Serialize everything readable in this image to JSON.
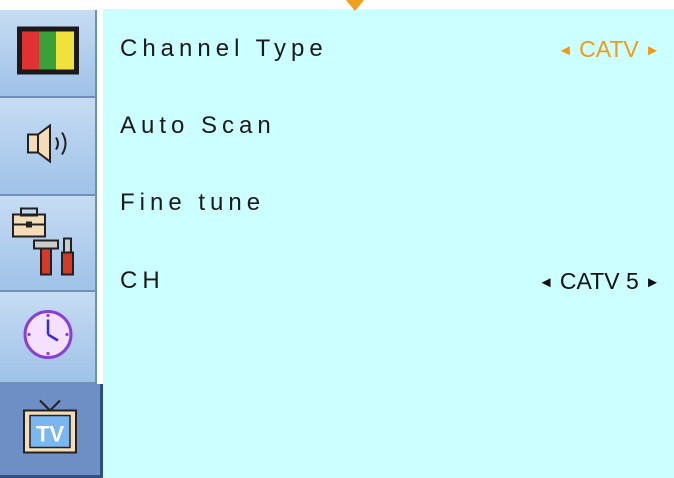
{
  "sidebar": {
    "tabs": [
      {
        "name": "picture",
        "icon": "color-bars-icon",
        "active": false
      },
      {
        "name": "sound",
        "icon": "speaker-icon",
        "active": false
      },
      {
        "name": "setup",
        "icon": "toolbox-icon",
        "active": false
      },
      {
        "name": "timer",
        "icon": "clock-icon",
        "active": false
      },
      {
        "name": "tv",
        "icon": "tv-icon",
        "active": true,
        "icon_text": "TV"
      }
    ]
  },
  "menu": {
    "items": [
      {
        "label": "Channel Type",
        "value": "CATV",
        "highlighted": true
      },
      {
        "label": "Auto Scan",
        "value": ""
      },
      {
        "label": "Fine tune",
        "value": ""
      },
      {
        "label": "CH",
        "value": "CATV 5",
        "highlighted": false
      }
    ],
    "arrow_left": "◄",
    "arrow_right": "►"
  },
  "colors": {
    "panel_bg": "#ccffff",
    "highlight": "#f29a18",
    "sidebar_tab": "#b4d0ee",
    "sidebar_active": "#6d8fc5"
  }
}
